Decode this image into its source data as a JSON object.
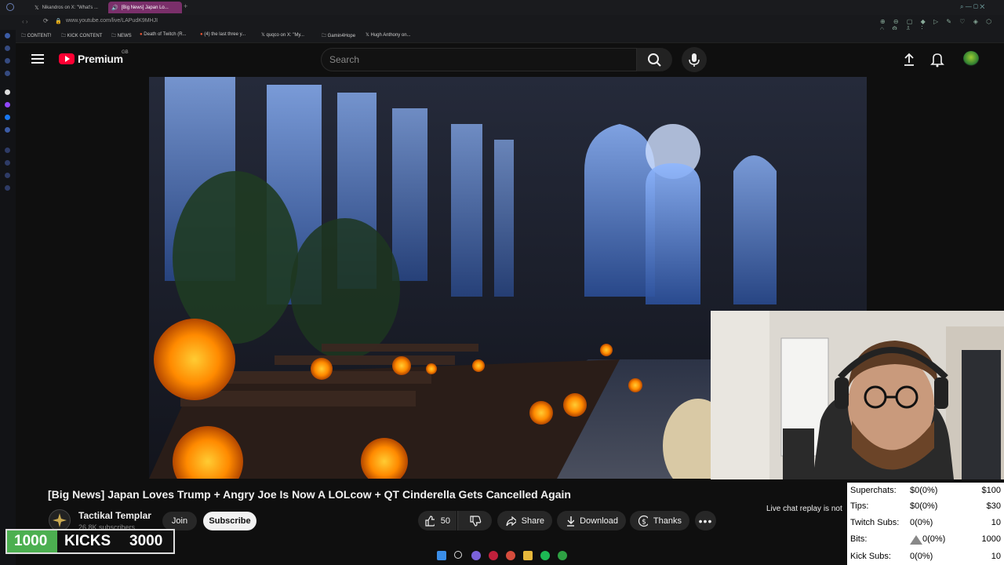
{
  "browser": {
    "tabs": [
      {
        "label": "Nikandros on X: \"What's ..."
      },
      {
        "label": "[Big News] Japan Lo..."
      }
    ],
    "url": "www.youtube.com/live/LAPudK9MHJI",
    "bookmarks": [
      "CONTENT!",
      "KICK CONTENT",
      "NEWS",
      "Death of Twitch (R...",
      "(4) the last three y...",
      "quqco on X: \"My...",
      "Gamin4Hope",
      "Hugh Anthony on..."
    ]
  },
  "youtube": {
    "logo_text": "Premium",
    "region": "GB",
    "search_placeholder": "Search"
  },
  "video": {
    "title": "[Big News] Japan Loves Trump + Angry Joe Is Now A LOLcow + QT Cinderella Gets Cancelled Again",
    "channel_name": "Tactikal Templar",
    "subscribers": "26.8K subscribers",
    "join_label": "Join",
    "subscribe_label": "Subscribe",
    "likes": "50",
    "share_label": "Share",
    "download_label": "Download",
    "thanks_label": "Thanks",
    "chat_replay_text": "Live chat replay is not"
  },
  "kicks_overlay": {
    "current": "1000",
    "label": "KICKS",
    "goal": "3000"
  },
  "stats_overlay": {
    "rows": [
      {
        "label": "Superchats:",
        "value": "$0(0%)",
        "goal": "$100"
      },
      {
        "label": "Tips:",
        "value": "$0(0%)",
        "goal": "$30"
      },
      {
        "label": "Twitch Subs:",
        "value": "0(0%)",
        "goal": "10"
      },
      {
        "label": "Bits:",
        "value": "0(0%)",
        "goal": "1000"
      },
      {
        "label": "Kick Subs:",
        "value": "0(0%)",
        "goal": "10"
      }
    ]
  },
  "colors": {
    "youtube_red": "#ff0033",
    "kicks_green": "#4caf50",
    "background": "#0f0f0f"
  }
}
